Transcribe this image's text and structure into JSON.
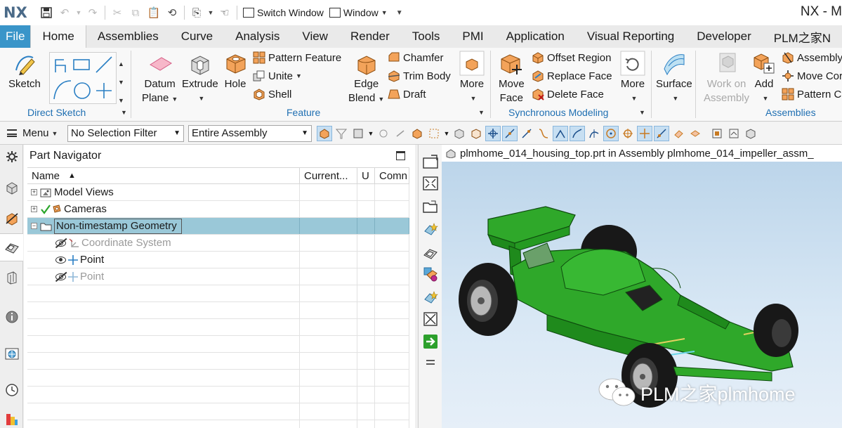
{
  "app": {
    "logo": "NX",
    "window_title": "NX - M",
    "quick_access": {
      "switch_window": "Switch Window",
      "window": "Window"
    }
  },
  "tabs": [
    "File",
    "Home",
    "Assemblies",
    "Curve",
    "Analysis",
    "View",
    "Render",
    "Tools",
    "PMI",
    "Application",
    "Visual Reporting",
    "Developer",
    "PLM之家N"
  ],
  "active_tab": "Home",
  "ribbon": {
    "direct_sketch": {
      "label": "Direct Sketch",
      "sketch": "Sketch"
    },
    "feature": {
      "label": "Feature",
      "datum_plane": [
        "Datum",
        "Plane"
      ],
      "extrude": "Extrude",
      "hole": "Hole",
      "pattern_feature": "Pattern Feature",
      "unite": "Unite",
      "shell": "Shell",
      "edge_blend": [
        "Edge",
        "Blend"
      ],
      "chamfer": "Chamfer",
      "trim_body": "Trim Body",
      "draft": "Draft",
      "more": "More"
    },
    "synchronous_modeling": {
      "label": "Synchronous Modeling",
      "move_face": [
        "Move",
        "Face"
      ],
      "offset_region": "Offset Region",
      "replace_face": "Replace Face",
      "delete_face": "Delete Face",
      "more": "More"
    },
    "surface": "Surface",
    "assemblies": {
      "label": "Assemblies",
      "work_on_assembly": [
        "Work on",
        "Assembly"
      ],
      "add": "Add",
      "assembly": "Assembly",
      "move_component": "Move Cor",
      "pattern_component": "Pattern Co"
    }
  },
  "selection_bar": {
    "menu": "Menu",
    "filter": "No Selection Filter",
    "scope": "Entire Assembly"
  },
  "part_navigator": {
    "title": "Part Navigator",
    "columns": [
      "Name",
      "Current...",
      "U",
      "Comn"
    ],
    "rows": [
      {
        "label": "Model Views",
        "level": 0,
        "expander": "+",
        "state": "normal"
      },
      {
        "label": "Cameras",
        "level": 0,
        "expander": "+",
        "state": "normal",
        "checked": true
      },
      {
        "label": "Non-timestamp Geometry",
        "level": 0,
        "expander": "−",
        "state": "selected"
      },
      {
        "label": "Coordinate System",
        "level": 1,
        "state": "hidden"
      },
      {
        "label": "Point",
        "level": 1,
        "state": "visible"
      },
      {
        "label": "Point",
        "level": 1,
        "state": "hidden"
      }
    ]
  },
  "viewport": {
    "title": "plmhome_014_housing_top.prt in Assembly plmhome_014_impeller_assm_",
    "model_color": "#2fa82a",
    "watermark": "PLM之家plmhome"
  },
  "colors": {
    "file_tab": "#3a95c9",
    "group_label": "#1f6fb2",
    "selected_row": "#9ac8d8"
  }
}
